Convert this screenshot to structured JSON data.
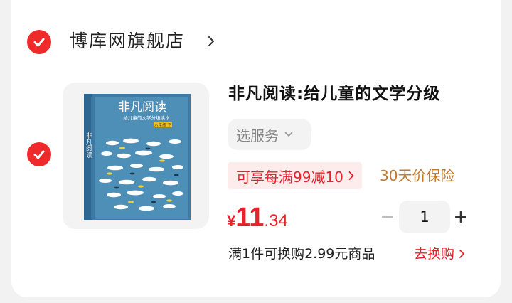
{
  "store": {
    "name": "博库网旗舰店"
  },
  "product": {
    "title": "非凡阅读:给儿童的文学分级",
    "service_label": "选服务",
    "promo": "可享每满99减10",
    "guarantee": "30天价保险",
    "price": {
      "symbol": "¥",
      "integer": "11",
      "decimal": ".34"
    },
    "quantity": "1",
    "trade_in_text": "满1件可换购2.99元商品",
    "trade_in_link": "去换购",
    "cover": {
      "title": "非凡阅读",
      "subtitle": "给儿童的文学分级读本",
      "badge": "六年级 下",
      "spine_text": "非凡阅读"
    }
  },
  "colors": {
    "accent": "#e8212a",
    "promo_bg": "#fdecec",
    "guarantee": "#c4782b",
    "cover_bg": "#4e8fb8"
  }
}
